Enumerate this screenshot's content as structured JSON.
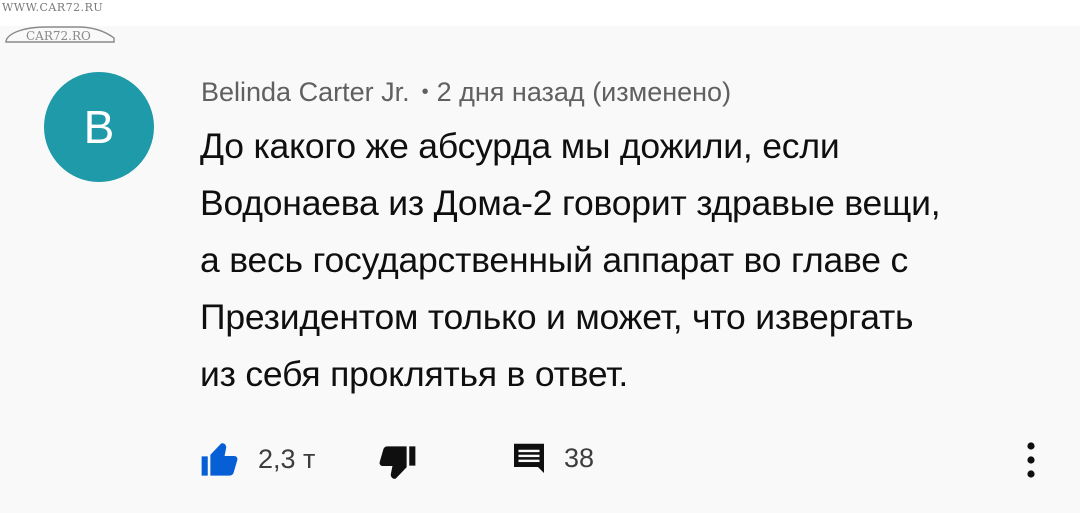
{
  "watermark": {
    "site_top": "WWW.CAR72.RU",
    "site_logo": "CAR72.RO"
  },
  "comment": {
    "avatar_letter": "B",
    "author": "Belinda Carter Jr.",
    "separator": "•",
    "time": "2 дня назад (изменено)",
    "text_lines": [
      "До какого же абсурда мы дожили, если",
      "Водонаева из Дома-2 говорит здравые вещи,",
      "а весь государственный аппарат во главе с",
      "Президентом только и может, что извергать",
      "из себя проклятья в ответ."
    ],
    "like_count": "2,3 т",
    "reply_count": "38"
  },
  "icons": {
    "like": "thumbs-up-icon",
    "dislike": "thumbs-down-icon",
    "reply": "comment-icon",
    "more": "more-vert-icon"
  },
  "colors": {
    "avatar_bg": "#1e9aa8",
    "like_active": "#065fd4",
    "meta_text": "#606060",
    "body_text": "#0f0f0f",
    "background": "#f9f9f9"
  }
}
